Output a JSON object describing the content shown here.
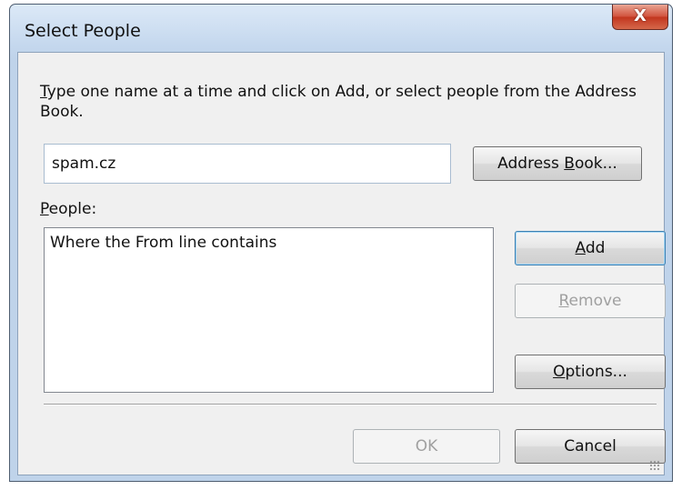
{
  "window": {
    "title": "Select People",
    "close_label": "X"
  },
  "instructions": {
    "mnemonic": "T",
    "rest": "ype one name at a time and click on Add, or select people from the Address Book."
  },
  "name_field": {
    "value": "spam.cz"
  },
  "buttons": {
    "address_book": {
      "before": "Address ",
      "mnemonic": "B",
      "after": "ook..."
    },
    "add": {
      "before": "",
      "mnemonic": "A",
      "after": "dd"
    },
    "remove": {
      "before": "",
      "mnemonic": "R",
      "after": "emove"
    },
    "options": {
      "before": "",
      "mnemonic": "O",
      "after": "ptions..."
    },
    "ok": {
      "label": "OK"
    },
    "cancel": {
      "label": "Cancel"
    }
  },
  "people": {
    "label": {
      "mnemonic": "P",
      "rest": "eople:"
    },
    "items": [
      "Where the From line contains"
    ]
  },
  "icons": {
    "close": "close-icon",
    "resize": "resize-grip-icon"
  }
}
